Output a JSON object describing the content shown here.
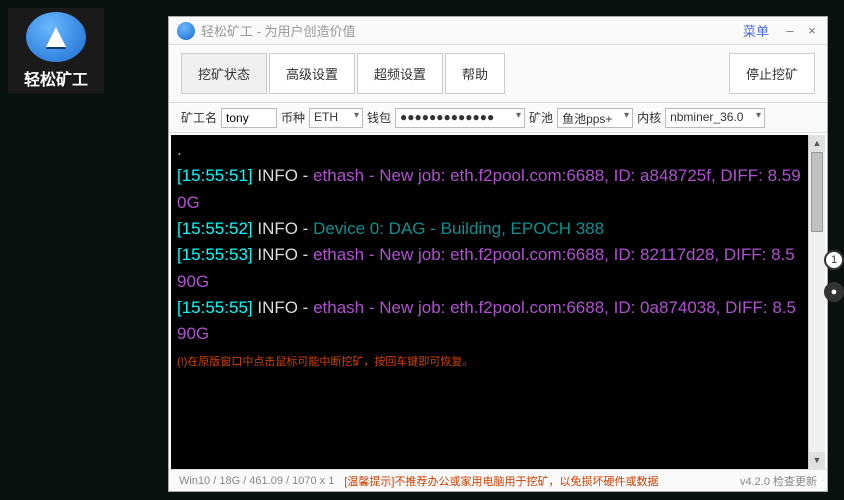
{
  "desktop": {
    "label": "轻松矿工"
  },
  "window": {
    "title": "轻松矿工 - 为用户创造价值",
    "menu": "菜单",
    "minimize": "–",
    "close": "×"
  },
  "tabs": {
    "t1": "挖矿状态",
    "t2": "高级设置",
    "t3": "超频设置",
    "t4": "帮助",
    "stop": "停止挖矿"
  },
  "fields": {
    "miner_label": "矿工名",
    "miner_value": "tony",
    "coin_label": "币种",
    "coin_value": "ETH",
    "wallet_label": "钱包",
    "wallet_value": "●●●●●●●●●●●●●",
    "pool_label": "矿池",
    "pool_value": "鱼池pps+",
    "kernel_label": "内核",
    "kernel_value": "nbminer_36.0"
  },
  "console": {
    "dot": ".",
    "l1a": "[15:55:51]",
    "l1b": " INFO - ",
    "l1c": "ethash",
    "l1d": " - New job: eth.f2pool.com:6688, ID: a848725f, DIFF: 8.590G",
    "l2a": "[15:55:52]",
    "l2b": " INFO - ",
    "l2c": "Device 0: DAG - Building, EPOCH 388",
    "l3a": "[15:55:53]",
    "l3b": " INFO - ",
    "l3c": "ethash",
    "l3d": " - New job: eth.f2pool.com:6688, ID: 82117d28, DIFF: 8.590G",
    "l4a": "[15:55:55]",
    "l4b": " INFO - ",
    "l4c": "ethash",
    "l4d": " - New job: eth.f2pool.com:6688, ID: 0a874038, DIFF: 8.590G",
    "warn": "(!)在原版窗口中点击鼠标可能中断挖矿，按回车键即可恢复。"
  },
  "status": {
    "sys": "Win10  /  18G / 461.09  / 1070 x 1",
    "tip": "[温馨提示]不推荐办公或家用电脑用于挖矿，以免损坏硬件或数据",
    "ver": "v4.2.0 检查更新"
  }
}
